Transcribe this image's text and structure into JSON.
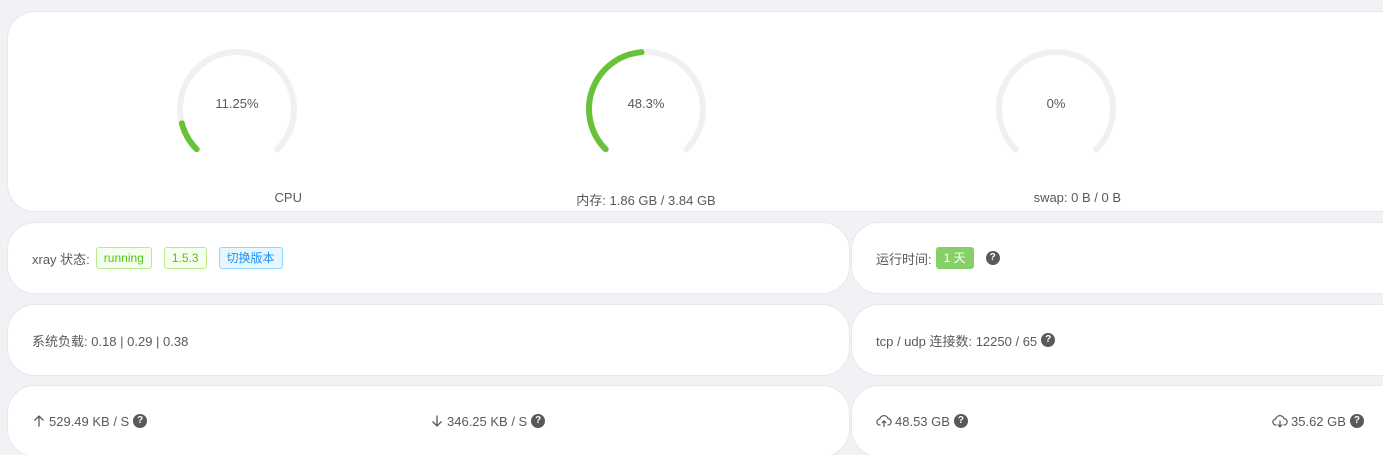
{
  "gauges": [
    {
      "percent_text": "11.25%",
      "percent": 11.25,
      "label": "CPU"
    },
    {
      "percent_text": "48.3%",
      "percent": 48.3,
      "label": "内存: 1.86 GB / 3.84 GB"
    },
    {
      "percent_text": "0%",
      "percent": 0,
      "label": "swap: 0 B / 0 B"
    }
  ],
  "xray": {
    "label": "xray 状态:",
    "status": "running",
    "version": "1.5.3",
    "switch_label": "切换版本"
  },
  "uptime": {
    "label": "运行时间:",
    "value": "1 天"
  },
  "load": {
    "label": "系统负载: 0.18 | 0.29 | 0.38"
  },
  "connections": {
    "label": "tcp / udp 连接数: 12250 / 65"
  },
  "speed": {
    "up": "529.49 KB / S",
    "down": "346.25 KB / S"
  },
  "traffic": {
    "sent": "48.53 GB",
    "received": "35.62 GB"
  },
  "help_glyph": "?",
  "colors": {
    "gauge_fill": "#67c23a",
    "gauge_track": "#f0f0f0"
  }
}
